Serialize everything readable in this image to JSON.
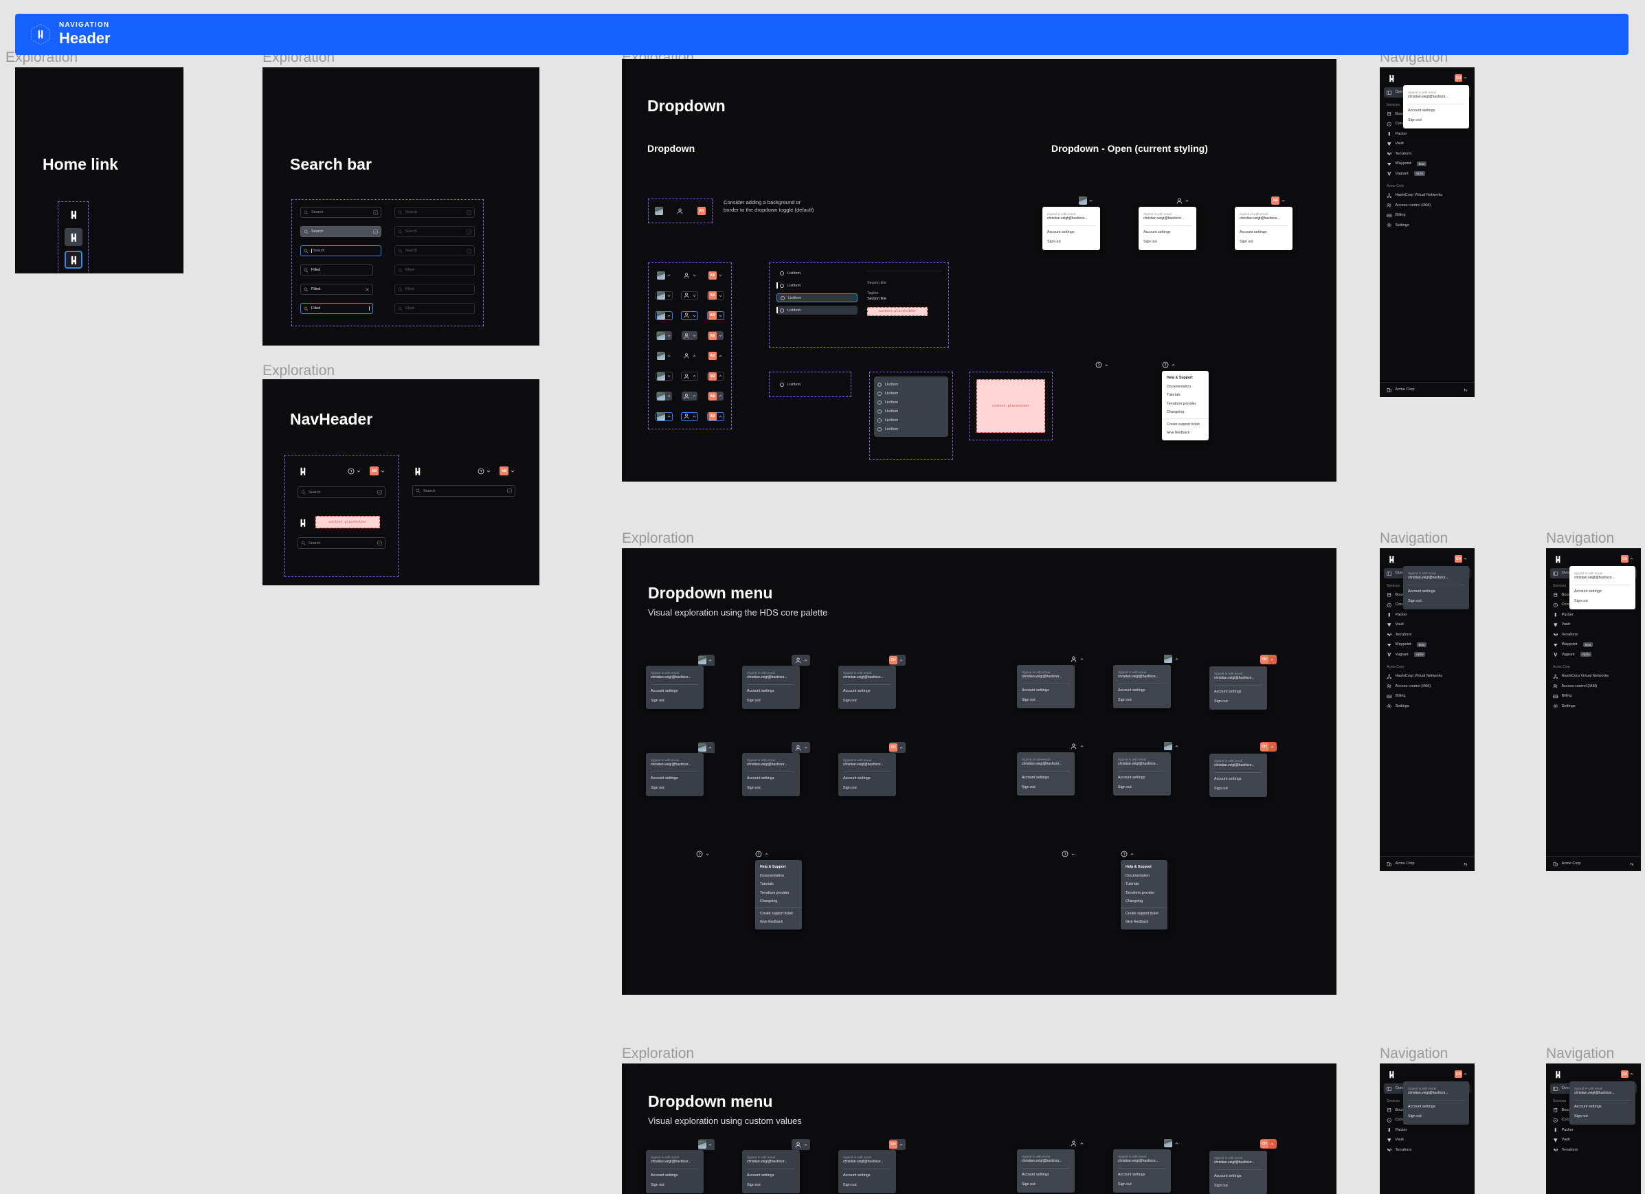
{
  "header": {
    "kicker": "NAVIGATION",
    "title": "Header",
    "logo_icon": "hashicorp-logo-icon",
    "accent_color": "#1762ff"
  },
  "section_labels": {
    "exploration": "Exploration",
    "navigation": "Navigation"
  },
  "frames": {
    "home_link": {
      "title": "Home link"
    },
    "search_bar": {
      "title": "Search bar"
    },
    "nav_header": {
      "title": "NavHeader"
    },
    "dropdown": {
      "title": "Dropdown",
      "subsection_left": "Dropdown",
      "subsection_right": "Dropdown - Open (current styling)",
      "note": "Consider adding a background or border to the dropdown toggle (default)",
      "section_title": "Section title",
      "tagline": "Tagline",
      "listitem_label": "ListItem"
    },
    "dropdown_menu_hds": {
      "title": "Dropdown menu",
      "subtitle": "Visual exploration using the HDS core palette"
    },
    "dropdown_menu_custom": {
      "title": "Dropdown menu",
      "subtitle": "Visual exploration using custom values"
    }
  },
  "search": {
    "placeholder": "Search",
    "filled_value": "Filled",
    "search_icon": "search-icon",
    "command_icon": "command-key-icon",
    "clear_icon": "close-icon"
  },
  "placeholder_text": "content placeholder",
  "user_menu": {
    "signed_in_label": "Signed in with email",
    "email": "christian.veigt@hashicor...",
    "items": [
      "Account settings",
      "Sign out"
    ],
    "initials": "AB",
    "initials_alt": "CH",
    "avatar_color": "#fa7f63"
  },
  "help_menu": {
    "items": [
      "Help & Support",
      "Documentation",
      "Tutorials",
      "Terraform provider",
      "Changelog",
      "Create support ticket",
      "Give feedback"
    ],
    "divider_after_index": 4,
    "help_icon": "help-circle-icon"
  },
  "nav_sidebar": {
    "logo_icon": "hashicorp-logo-icon",
    "user_initials": "CH",
    "overview_item": {
      "label": "Overview",
      "icon": "overview-icon"
    },
    "services_section": "Services",
    "services": [
      {
        "label": "Boundary",
        "icon": "boundary-icon",
        "badge": ""
      },
      {
        "label": "Consul",
        "icon": "consul-icon",
        "badge": ""
      },
      {
        "label": "Packer",
        "icon": "packer-icon",
        "badge": ""
      },
      {
        "label": "Vault",
        "icon": "vault-icon",
        "badge": ""
      },
      {
        "label": "Terraform",
        "icon": "terraform-icon",
        "badge": ""
      },
      {
        "label": "Waypoint",
        "icon": "waypoint-icon",
        "badge": "Beta"
      },
      {
        "label": "Vagrant",
        "icon": "vagrant-icon",
        "badge": "Alpha"
      }
    ],
    "org_section": "Acme Corp",
    "org_items": [
      {
        "label": "HashiCorp Virtual Networks",
        "icon": "network-icon"
      },
      {
        "label": "Access control (IAM)",
        "icon": "users-icon"
      },
      {
        "label": "Billing",
        "icon": "credit-card-icon"
      },
      {
        "label": "Settings",
        "icon": "gear-icon"
      }
    ],
    "footer": {
      "label": "Acme Corp",
      "icon": "org-icon",
      "switcher_icon": "swap-vertical-icon"
    }
  }
}
